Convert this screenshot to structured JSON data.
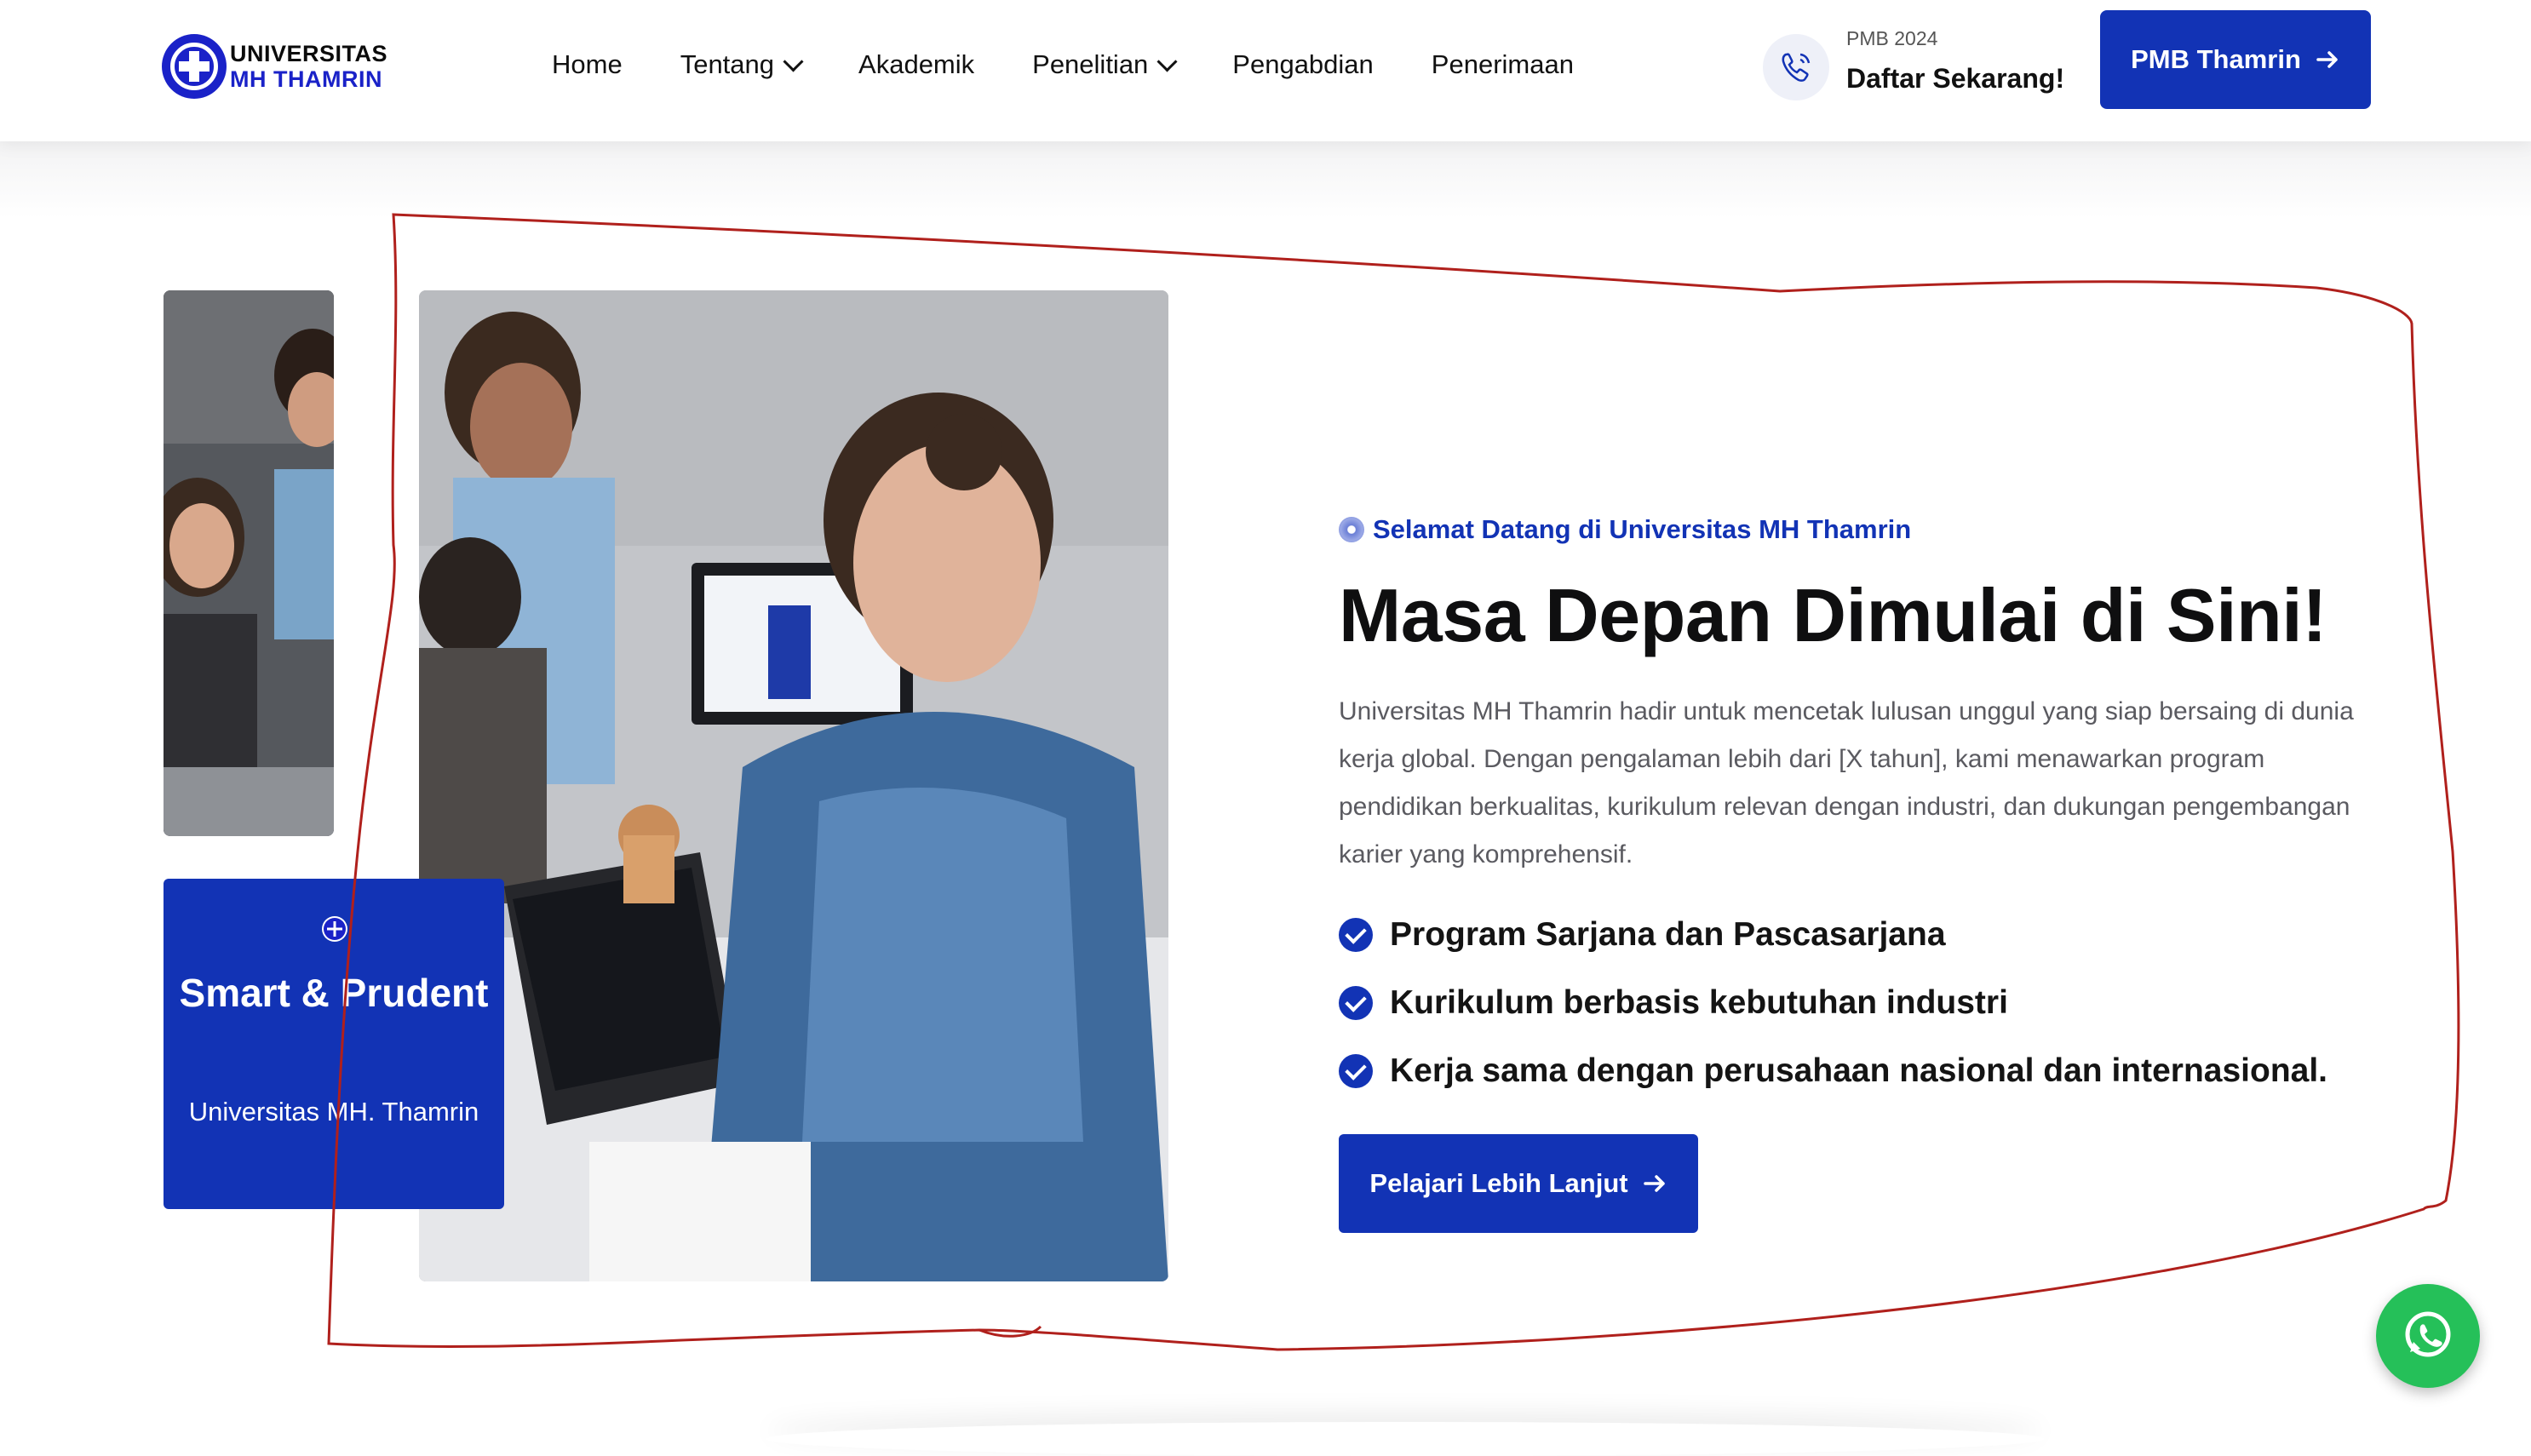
{
  "header": {
    "logo": {
      "line1": "UNIVERSITAS",
      "line2": "MH THAMRIN"
    },
    "nav": [
      {
        "label": "Home",
        "has_dropdown": false
      },
      {
        "label": "Tentang",
        "has_dropdown": true
      },
      {
        "label": "Akademik",
        "has_dropdown": false
      },
      {
        "label": "Penelitian",
        "has_dropdown": true
      },
      {
        "label": "Pengabdian",
        "has_dropdown": false
      },
      {
        "label": "Penerimaan",
        "has_dropdown": false
      }
    ],
    "cta": {
      "small": "PMB 2024",
      "big": "Daftar Sekarang!",
      "icon": "phone-icon"
    },
    "button": {
      "label": "PMB Thamrin",
      "icon": "arrow-right-icon"
    }
  },
  "card": {
    "title": "Smart & Prudent",
    "subtitle": "Universitas MH. Thamrin"
  },
  "hero": {
    "eyebrow": "Selamat Datang di Universitas MH Thamrin",
    "heading": "Masa Depan Dimulai di Sini!",
    "paragraph": "Universitas MH Thamrin hadir untuk mencetak lulusan unggul yang siap bersaing di dunia kerja global. Dengan pengalaman lebih dari [X tahun], kami menawarkan program pendidikan berkualitas, kurikulum relevan dengan industri, dan dukungan pengembangan karier yang komprehensif.",
    "features": [
      "Program Sarjana dan Pascasarjana",
      "Kurikulum berbasis kebutuhan industri",
      "Kerja sama dengan perusahaan nasional dan internasional."
    ],
    "button": "Pelajari Lebih Lanjut"
  },
  "colors": {
    "primary": "#1233b5",
    "whatsapp": "#25c059",
    "annotation": "#b0201c"
  }
}
